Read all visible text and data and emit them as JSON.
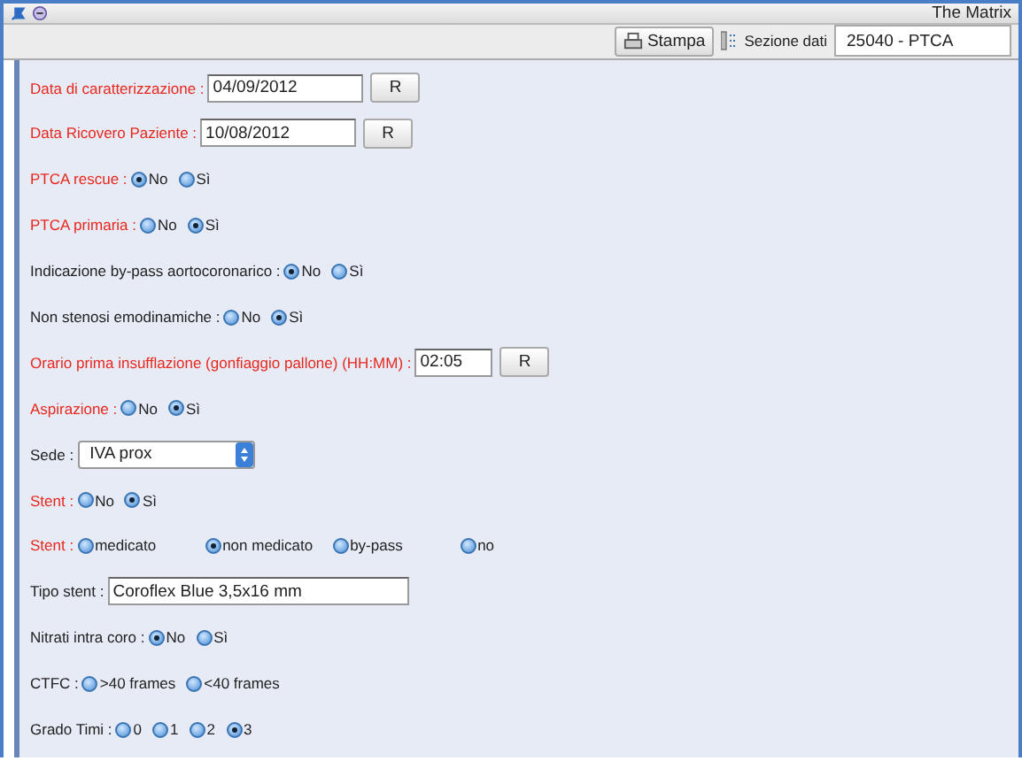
{
  "window": {
    "title": "The Matrix"
  },
  "toolbar": {
    "print_button": "Stampa",
    "section_label": "Sezione dati",
    "section_value": "25040 - PTCA"
  },
  "form": [
    {
      "kind": "date",
      "label": "Data di caratterizzazione :",
      "required": true,
      "value": "04/09/2012",
      "button": "R"
    },
    {
      "kind": "date",
      "label": "Data Ricovero Paziente :",
      "required": true,
      "value": "10/08/2012",
      "button": "R"
    },
    {
      "kind": "radio",
      "label": "PTCA rescue :",
      "required": true,
      "options": [
        {
          "label": "No",
          "selected": true
        },
        {
          "label": "Sì",
          "selected": false
        }
      ]
    },
    {
      "kind": "radio",
      "label": "PTCA primaria :",
      "required": true,
      "options": [
        {
          "label": "No",
          "selected": false
        },
        {
          "label": "Sì",
          "selected": true
        }
      ]
    },
    {
      "kind": "radio",
      "label": "Indicazione by-pass aortocoronarico :",
      "required": false,
      "options": [
        {
          "label": "No",
          "selected": true
        },
        {
          "label": "Sì",
          "selected": false
        }
      ]
    },
    {
      "kind": "radio",
      "label": "Non stenosi emodinamiche :",
      "required": false,
      "options": [
        {
          "label": "No",
          "selected": false
        },
        {
          "label": "Sì",
          "selected": true
        }
      ]
    },
    {
      "kind": "time",
      "label": "Orario prima insufflazione (gonfiaggio pallone) (HH:MM) :",
      "required": true,
      "value": "02:05",
      "button": "R"
    },
    {
      "kind": "radio",
      "label": "Aspirazione :",
      "required": true,
      "options": [
        {
          "label": "No",
          "selected": false
        },
        {
          "label": "Sì",
          "selected": true
        }
      ]
    },
    {
      "kind": "select",
      "label": "Sede :",
      "required": false,
      "value": "IVA prox"
    },
    {
      "kind": "radio",
      "label": "Stent :",
      "required": true,
      "options": [
        {
          "label": "No",
          "selected": false
        },
        {
          "label": "Sì",
          "selected": true
        }
      ]
    },
    {
      "kind": "radio-wide",
      "label": "Stent :",
      "required": true,
      "options": [
        {
          "label": "medicato",
          "selected": false
        },
        {
          "label": "non medicato",
          "selected": true
        },
        {
          "label": "by-pass",
          "selected": false
        },
        {
          "label": "no",
          "selected": false
        }
      ]
    },
    {
      "kind": "text",
      "label": "Tipo stent :",
      "required": false,
      "value": "Coroflex Blue 3,5x16 mm"
    },
    {
      "kind": "radio",
      "label": "Nitrati intra coro :",
      "required": false,
      "options": [
        {
          "label": "No",
          "selected": true
        },
        {
          "label": "Sì",
          "selected": false
        }
      ]
    },
    {
      "kind": "radio",
      "label": "CTFC :",
      "required": false,
      "options": [
        {
          "label": ">40 frames",
          "selected": false
        },
        {
          "label": "<40 frames",
          "selected": false
        }
      ]
    },
    {
      "kind": "radio",
      "label": "Grado Timi :",
      "required": false,
      "options": [
        {
          "label": "0",
          "selected": false
        },
        {
          "label": "1",
          "selected": false
        },
        {
          "label": "2",
          "selected": false
        },
        {
          "label": "3",
          "selected": true
        }
      ]
    }
  ]
}
